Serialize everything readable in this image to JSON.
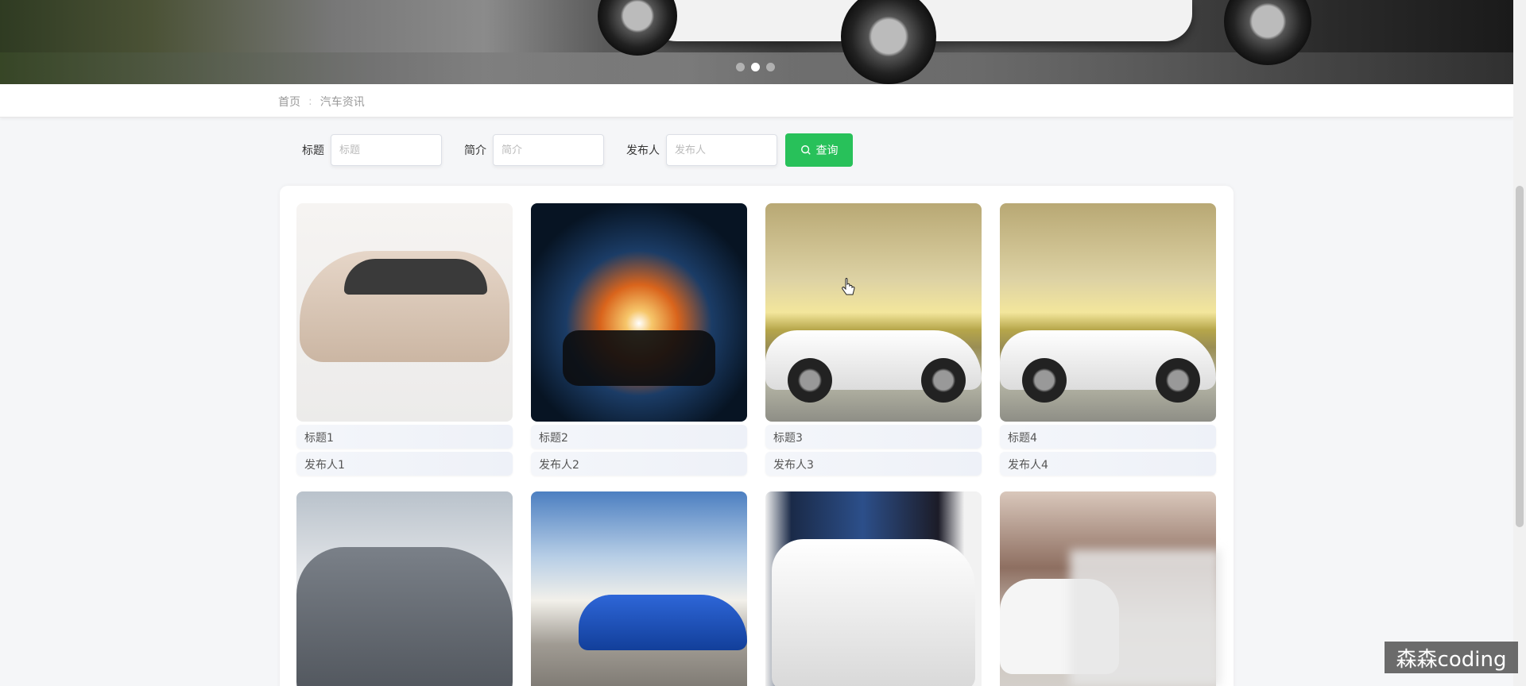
{
  "banner": {
    "slides": [
      "slide-1",
      "slide-2",
      "slide-3"
    ],
    "active_index": 1
  },
  "breadcrumb": {
    "home": "首页",
    "separator": ":",
    "current": "汽车资讯"
  },
  "search": {
    "title_label": "标题",
    "title_placeholder": "标题",
    "intro_label": "简介",
    "intro_placeholder": "简介",
    "publisher_label": "发布人",
    "publisher_placeholder": "发布人",
    "query_button": "查询",
    "query_icon": "search-icon",
    "accent_color": "#28c15a"
  },
  "cards": [
    {
      "title": "标题1",
      "publisher": "发布人1"
    },
    {
      "title": "标题2",
      "publisher": "发布人2"
    },
    {
      "title": "标题3",
      "publisher": "发布人3"
    },
    {
      "title": "标题4",
      "publisher": "发布人4"
    },
    {
      "title": "",
      "publisher": ""
    },
    {
      "title": "",
      "publisher": ""
    },
    {
      "title": "",
      "publisher": ""
    },
    {
      "title": "",
      "publisher": ""
    }
  ],
  "watermark": "森森coding"
}
